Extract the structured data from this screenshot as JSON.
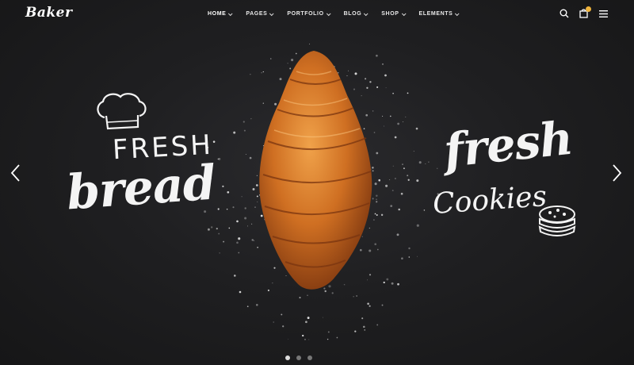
{
  "header": {
    "logo": "Baker",
    "nav": [
      {
        "label": "HOME"
      },
      {
        "label": "PAGES"
      },
      {
        "label": "PORTFOLIO"
      },
      {
        "label": "BLOG"
      },
      {
        "label": "SHOP"
      },
      {
        "label": "ELEMENTS"
      }
    ],
    "icons": [
      "search-icon",
      "cart-icon",
      "menu-icon"
    ],
    "accent": "#f0b43c"
  },
  "slide": {
    "left_line1": "FRESH",
    "left_line2": "bread",
    "right_line1": "fresh",
    "right_line2": "Cookies"
  },
  "slider": {
    "slide_count": 3,
    "active_index": 0
  },
  "colors": {
    "background": "#1b1b1d",
    "croissant": "#c8691e"
  }
}
